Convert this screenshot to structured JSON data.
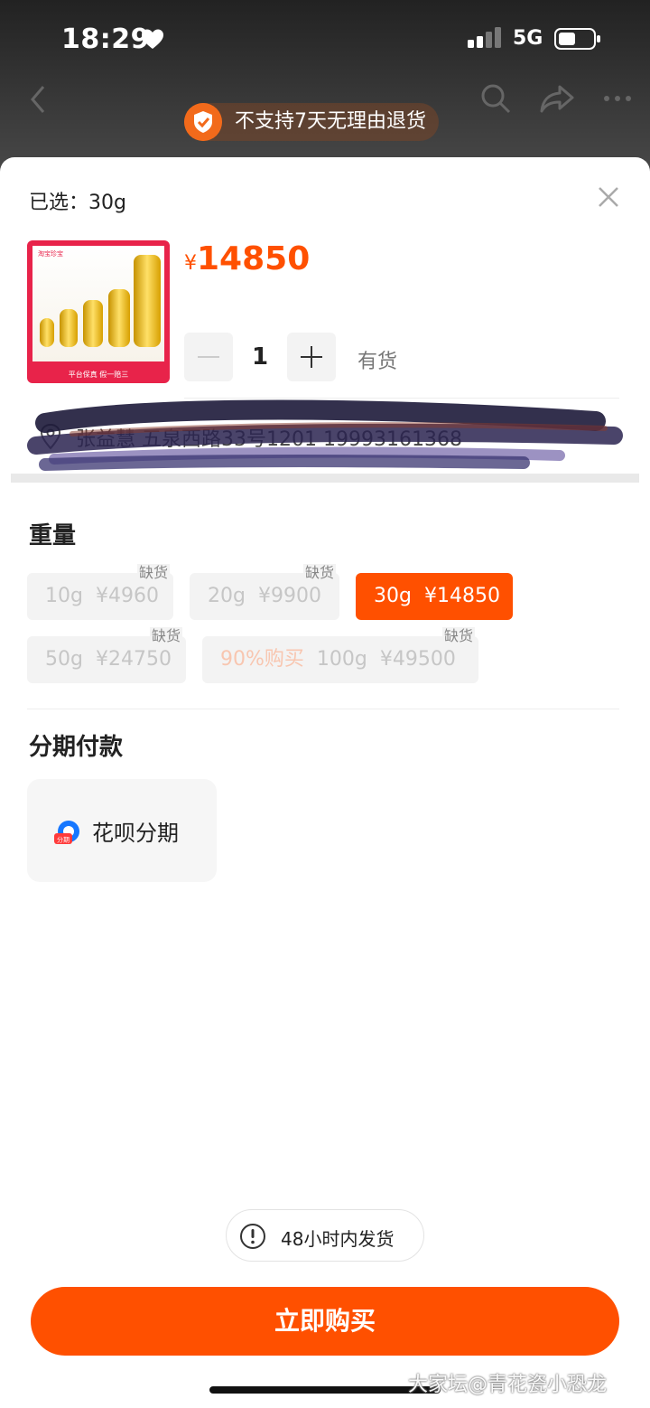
{
  "status_bar": {
    "time": "18:29",
    "network": "5G"
  },
  "notice": {
    "text": "不支持7天无理由退货"
  },
  "sheet": {
    "selected_label": "已选：30g",
    "product": {
      "price_symbol": "¥",
      "price": "14850",
      "image_logo_text": "淘宝珍宝",
      "image_caption": "平台保真  假一赔三"
    },
    "quantity": {
      "value": "1",
      "stock_status": "有货"
    },
    "address": {
      "text": "张益慧 五泉西路33号1201 19993161368"
    },
    "weight": {
      "title": "重量",
      "options": [
        {
          "label": "10g",
          "price": "¥4960",
          "tag": "缺货",
          "state": "out-of-stock"
        },
        {
          "label": "20g",
          "price": "¥9900",
          "tag": "缺货",
          "state": "out-of-stock"
        },
        {
          "label": "30g",
          "price": "¥14850",
          "tag": "",
          "state": "selected"
        },
        {
          "label": "50g",
          "price": "¥24750",
          "tag": "缺货",
          "state": "out-of-stock"
        },
        {
          "promo": "90%购买",
          "label": "100g",
          "price": "¥49500",
          "tag": "缺货",
          "state": "out-of-stock"
        }
      ]
    },
    "installment": {
      "title": "分期付款",
      "option_label": "花呗分期",
      "icon_badge": "分期"
    },
    "shipping_notice": "48小时内发货",
    "buy_button": "立即购买"
  },
  "watermark": "大家坛@青花瓷小恐龙",
  "colors": {
    "accent": "#ff5000",
    "disabled_bg": "#f3f3f3"
  }
}
